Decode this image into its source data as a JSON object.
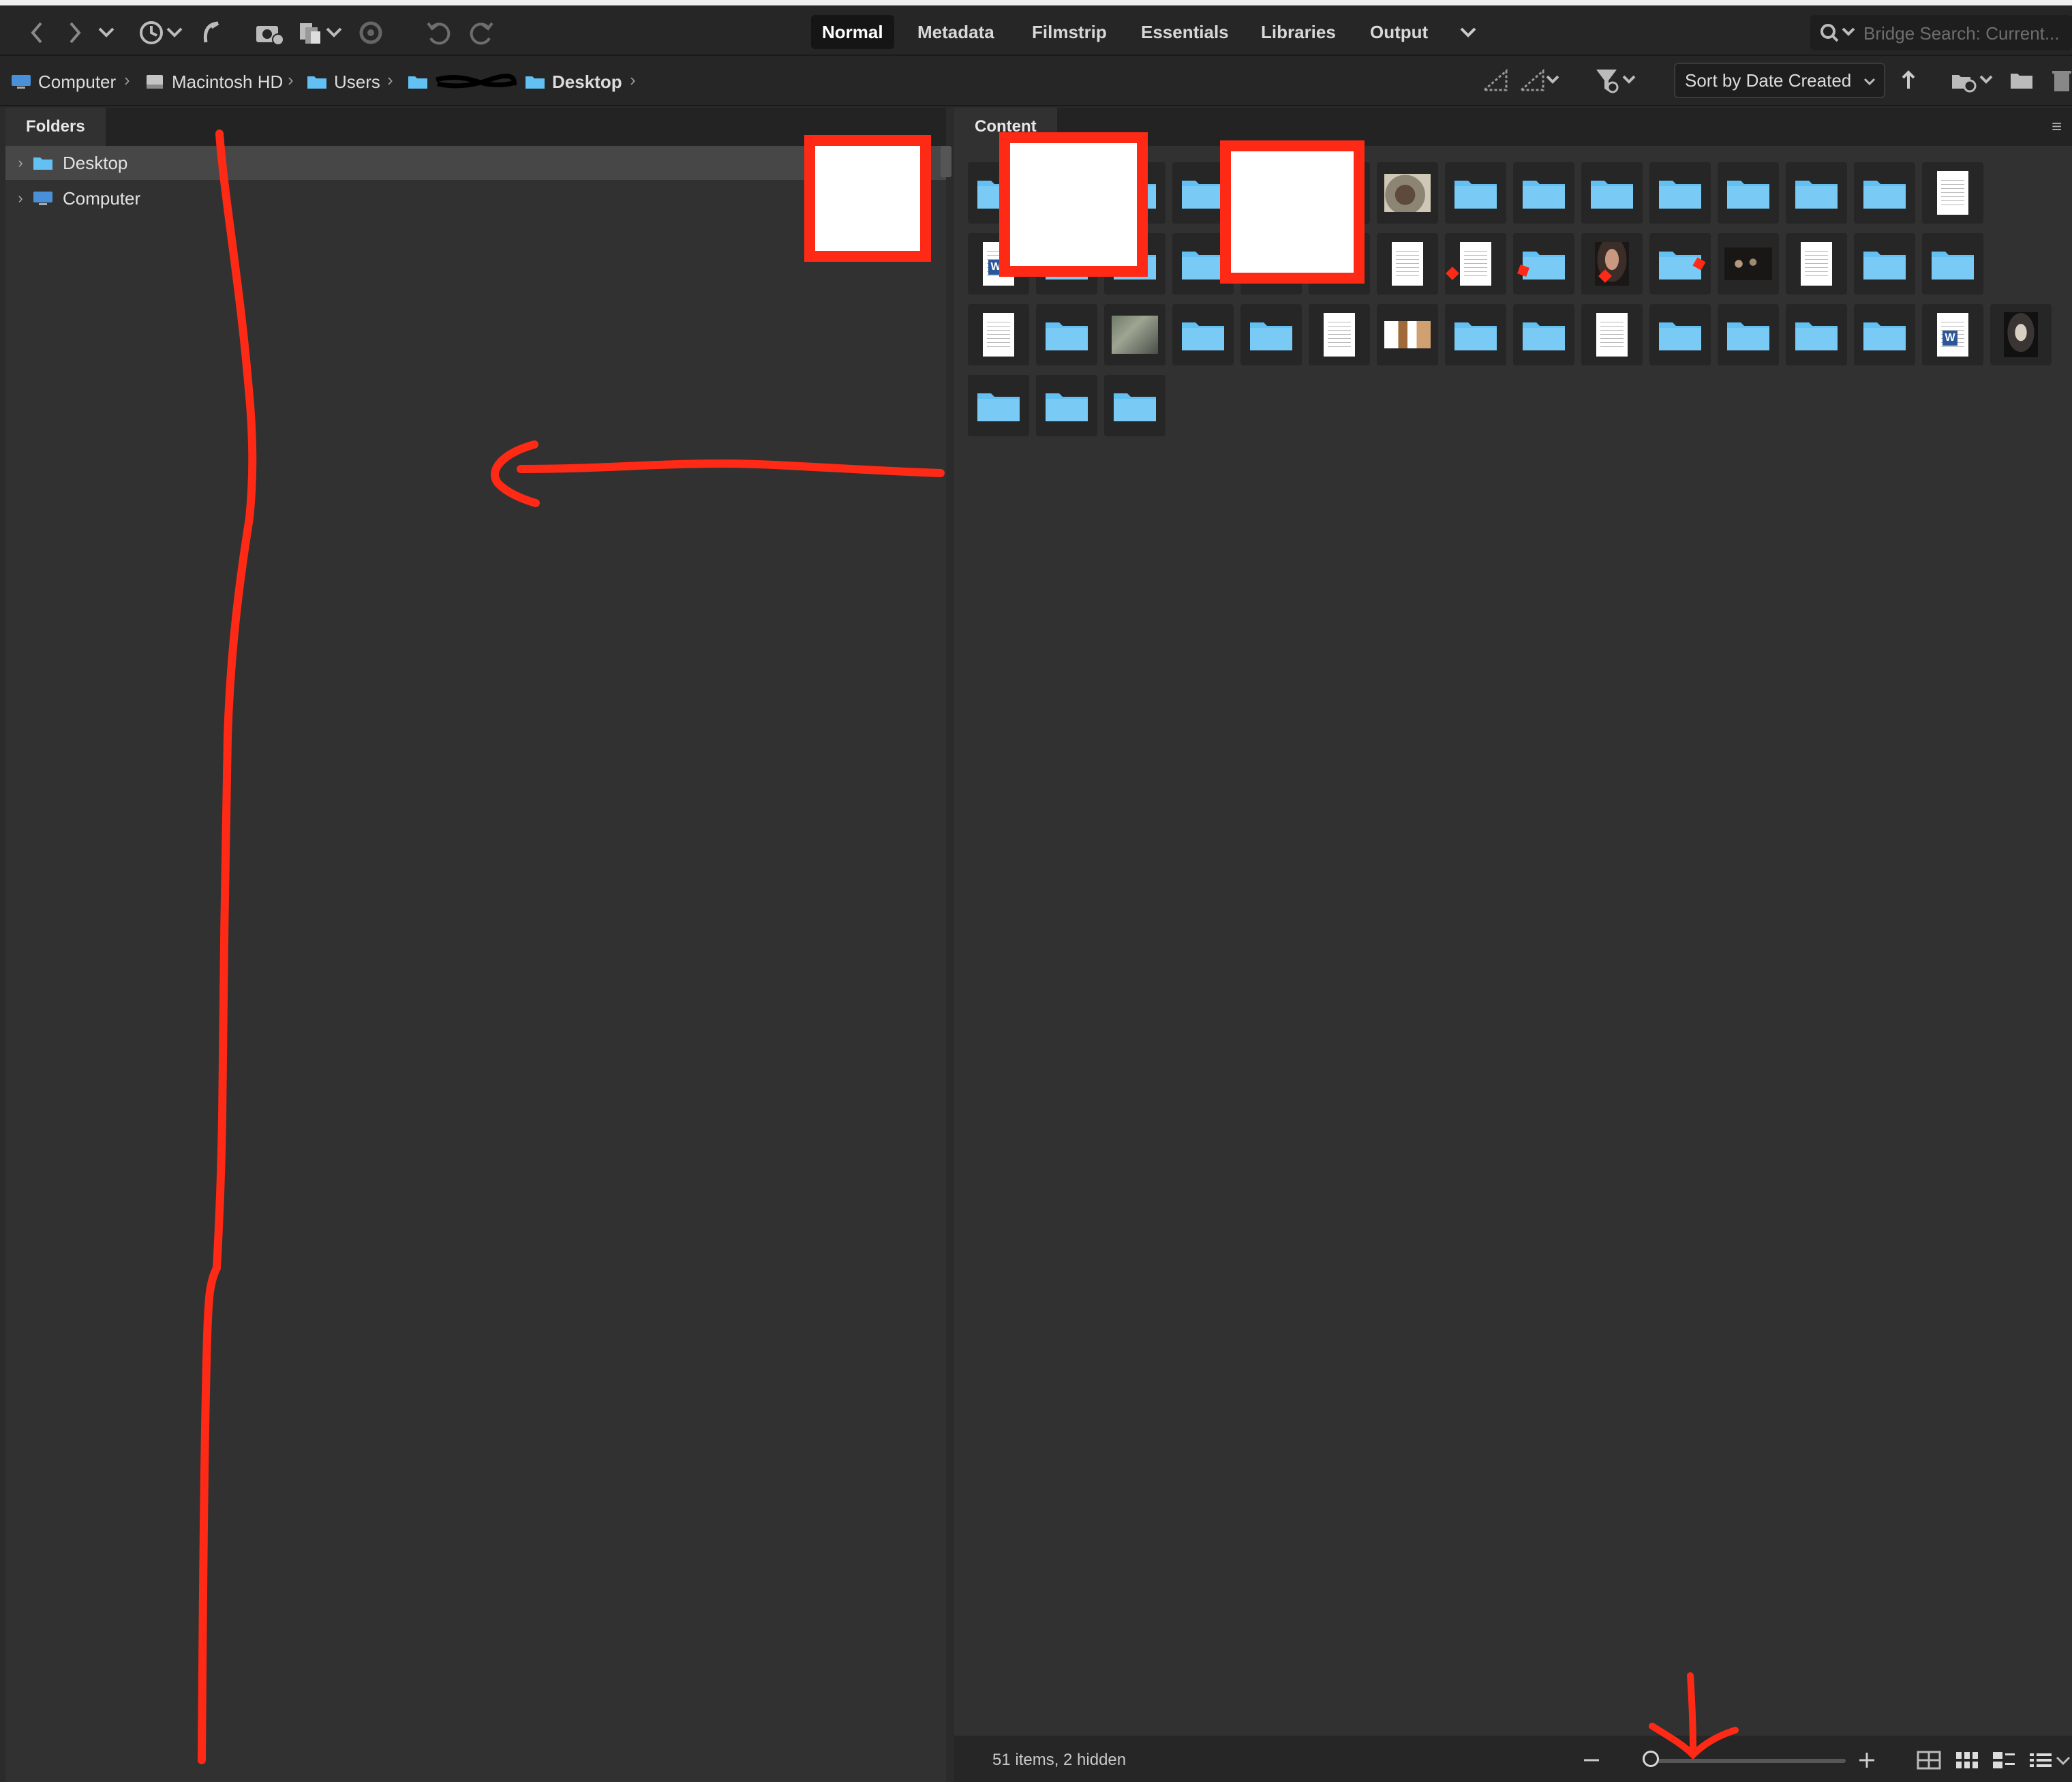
{
  "toolbar": {
    "workspace_tabs": [
      {
        "label": "Normal",
        "active": true
      },
      {
        "label": "Metadata",
        "active": false
      },
      {
        "label": "Filmstrip",
        "active": false
      },
      {
        "label": "Essentials",
        "active": false
      },
      {
        "label": "Libraries",
        "active": false
      },
      {
        "label": "Output",
        "active": false
      }
    ],
    "search_placeholder": "Bridge Search: Current..."
  },
  "pathbar": {
    "crumbs": [
      "Computer",
      "Macintosh HD",
      "Users",
      "Desktop"
    ],
    "sort_label": "Sort by Date Created"
  },
  "folders_panel": {
    "tab_label": "Folders",
    "items": [
      {
        "label": "Desktop",
        "selected": true,
        "icon": "folder-icon"
      },
      {
        "label": "Computer",
        "selected": false,
        "icon": "computer-icon"
      }
    ]
  },
  "content_panel": {
    "tab_label": "Content",
    "thumbnails": [
      "folder",
      "folder",
      "folder",
      "folder",
      "folder",
      "folder",
      "photo-cat",
      "folder",
      "folder",
      "folder",
      "folder",
      "folder",
      "folder",
      "folder",
      "doc",
      "word-doc",
      "folder",
      "folder",
      "folder",
      "folder",
      "folder",
      "doc",
      "doc",
      "folder",
      "photo-face",
      "folder",
      "photo-band",
      "doc",
      "folder",
      "folder",
      "doc",
      "folder",
      "photo-street",
      "folder",
      "folder",
      "doc",
      "photo-collage",
      "folder",
      "folder",
      "doc",
      "folder",
      "folder",
      "folder",
      "folder",
      "word-doc",
      "photo-portrait",
      "folder",
      "folder",
      "folder"
    ]
  },
  "status": {
    "items_text": "51 items, 2 hidden",
    "zoom_level": 0.0
  },
  "colors": {
    "folder_blue": "#62c0f2",
    "annotation_red": "#ff2a16",
    "active_tab_bg": "#151515"
  }
}
